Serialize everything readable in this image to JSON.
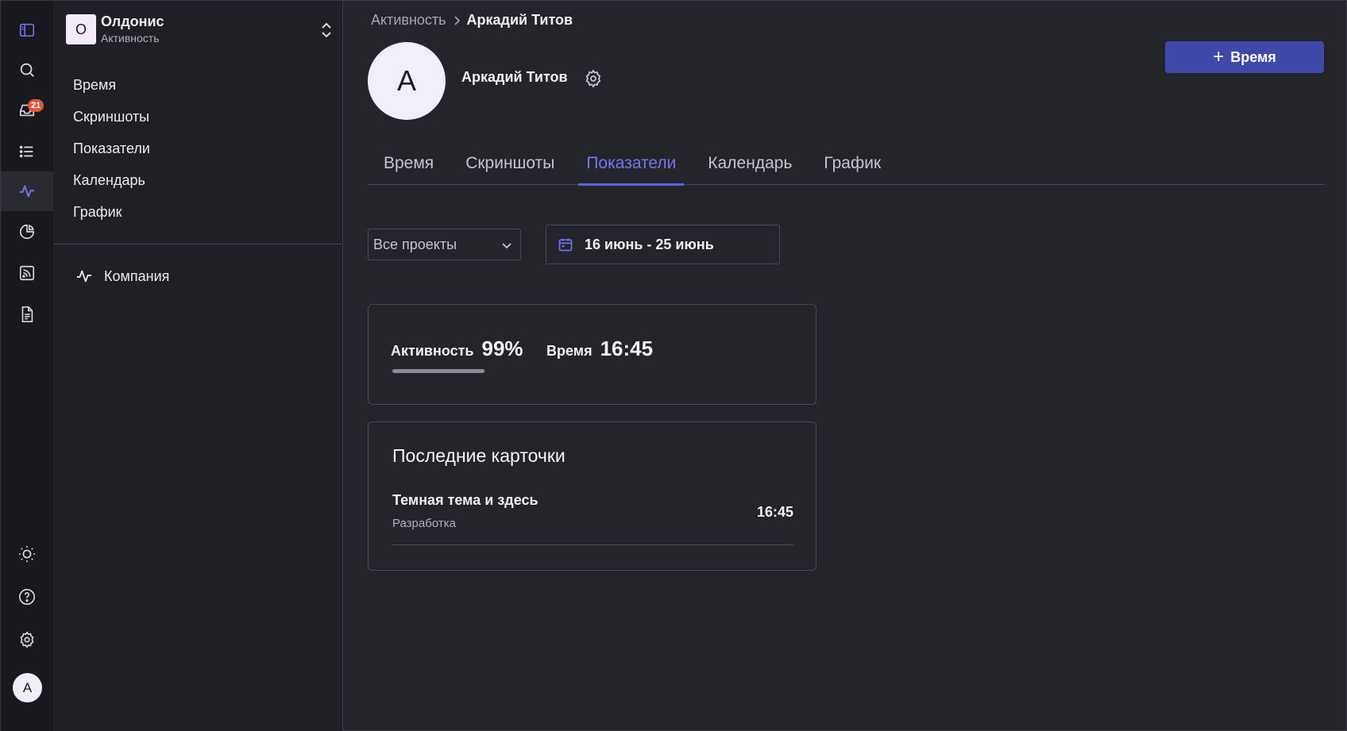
{
  "rail": {
    "inbox_badge": "21",
    "items": [
      "sidebar-toggle-icon",
      "search-icon",
      "inbox-icon",
      "list-icon",
      "activity-icon",
      "pie-chart-icon",
      "feed-icon",
      "document-icon"
    ],
    "bottom": [
      "sun-icon",
      "help-icon",
      "settings-icon"
    ],
    "avatar_initial": "A",
    "accent_color": "#6f73f0"
  },
  "sidebar": {
    "org_initial": "O",
    "org_name": "Олдонис",
    "org_subtitle": "Активность",
    "items": [
      {
        "label": "Время"
      },
      {
        "label": "Скриншоты"
      },
      {
        "label": "Показатели"
      },
      {
        "label": "Календарь"
      },
      {
        "label": "График"
      }
    ],
    "company_label": "Компания"
  },
  "breadcrumb": {
    "parent": "Активность",
    "current": "Аркадий Титов"
  },
  "header": {
    "add_button_label": "Время",
    "button_color": "#3f4aa8"
  },
  "profile": {
    "initial": "A",
    "name": "Аркадий Титов"
  },
  "tabs": [
    {
      "label": "Время",
      "active": false
    },
    {
      "label": "Скриншоты",
      "active": false
    },
    {
      "label": "Показатели",
      "active": true
    },
    {
      "label": "Календарь",
      "active": false
    },
    {
      "label": "График",
      "active": false
    }
  ],
  "filters": {
    "project_select": "Все проекты",
    "date_range": "16 июнь - 25 июнь"
  },
  "stats": {
    "activity_label": "Активность",
    "activity_value": "99%",
    "activity_progress": 0.99,
    "time_label": "Время",
    "time_value": "16:45"
  },
  "recent": {
    "title": "Последние карточки",
    "items": [
      {
        "name": "Темная тема и здесь",
        "project": "Разработка",
        "time": "16:45"
      }
    ]
  }
}
